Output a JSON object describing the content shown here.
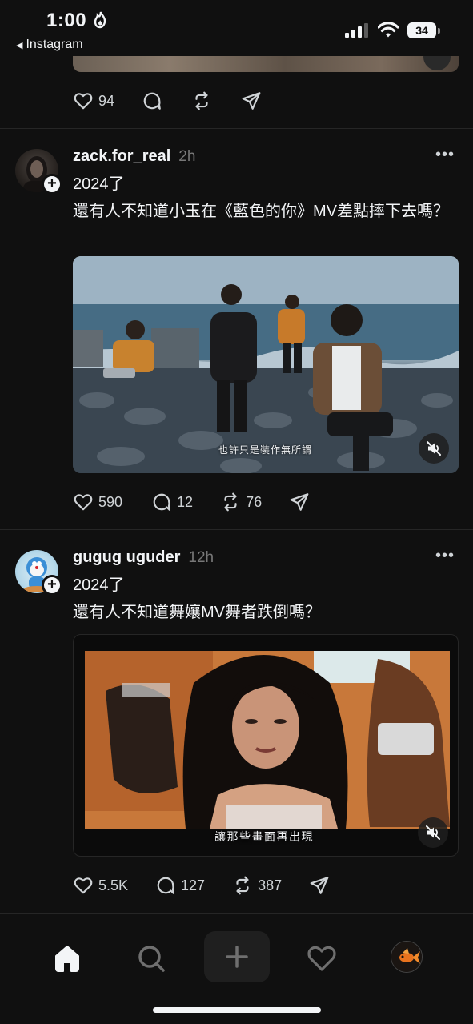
{
  "status_bar": {
    "time": "1:00",
    "back_label": "Instagram",
    "battery": "34"
  },
  "prev_post": {
    "likes": "94"
  },
  "posts": [
    {
      "username": "zack.for_real",
      "time_ago": "2h",
      "text": "2024了\n還有人不知道小玉在《藍色的你》MV差點摔下去嗎？",
      "video_subtitle": "也許只是裝作無所謂",
      "likes": "590",
      "replies": "12",
      "reposts": "76"
    },
    {
      "username": "gugug uguder",
      "time_ago": "12h",
      "text": "2024了\n還有人不知道舞孃MV舞者跌倒嗎？",
      "video_subtitle": "讓那些畫面再出現",
      "likes": "5.5K",
      "replies": "127",
      "reposts": "387"
    }
  ],
  "icons": {
    "like": "heart-icon",
    "reply": "comment-icon",
    "repost": "repost-icon",
    "share": "send-icon",
    "mute": "speaker-muted-icon",
    "more": "more-horizontal-icon"
  },
  "nav": {
    "items": [
      "home-icon",
      "search-icon",
      "create-icon",
      "activity-heart-icon",
      "profile-avatar"
    ]
  }
}
